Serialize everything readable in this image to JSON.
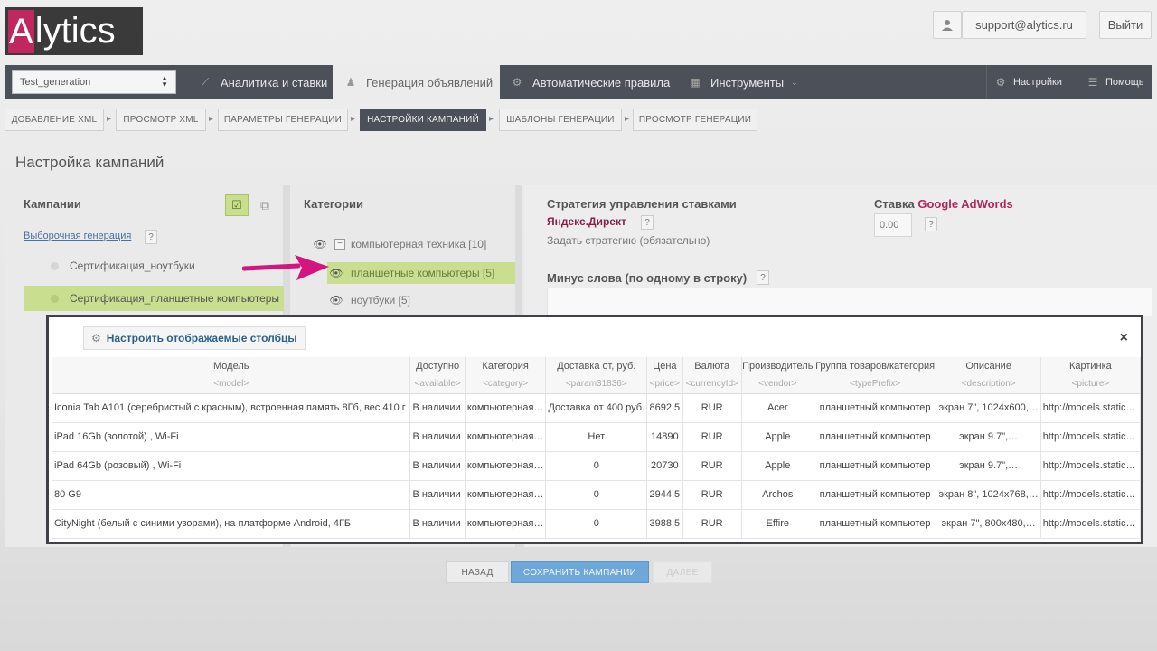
{
  "header": {
    "logo_text": "lytics",
    "logo_letter": "A",
    "support_email": "support@alytics.ru",
    "logout_label": "Выйти"
  },
  "topnav": {
    "project": "Test_generation",
    "tabs": [
      {
        "label": "Аналитика и ставки",
        "icon": "chart-icon"
      },
      {
        "label": "Генерация объявлений",
        "icon": "generator-icon"
      },
      {
        "label": "Автоматические правила",
        "icon": "rules-icon"
      },
      {
        "label": "Инструменты",
        "icon": "tools-icon"
      }
    ],
    "settings_label": "Настройки",
    "help_label": "Помощь"
  },
  "steps": [
    "ДОБАВЛЕНИЕ XML",
    "ПРОСМОТР XML",
    "ПАРАМЕТРЫ ГЕНЕРАЦИИ",
    "НАСТРОЙКИ КАМПАНИЙ",
    "ШАБЛОНЫ ГЕНЕРАЦИИ",
    "ПРОСМОТР ГЕНЕРАЦИИ"
  ],
  "page_title": "Настройка кампаний",
  "campaigns": {
    "title": "Кампании",
    "selective_link": "Выборочная генерация",
    "items": [
      "Сертификация_ноутбуки",
      "Сертификация_планшетные компьютеры"
    ]
  },
  "categories": {
    "title": "Категории",
    "items": [
      {
        "label": "компьютерная техника [10]"
      },
      {
        "label": "планшетные компьютеры [5]"
      },
      {
        "label": "ноутбуки [5]"
      }
    ]
  },
  "strategy": {
    "title": "Стратегия управления ставками",
    "system": "Яндекс.Директ",
    "set_strategy": "Задать стратегию (обязательно)",
    "bid_label": "Ставка",
    "bid_system": "Google AdWords",
    "bid_value": "0.00",
    "minus_label": "Минус слова (по одному в строку)",
    "qmark": "?"
  },
  "modal": {
    "configure_label": "Настроить отображаемые столбцы",
    "close": "×",
    "columns": [
      {
        "title": "Модель",
        "key": "<model>"
      },
      {
        "title": "Доступно",
        "key": "<available>"
      },
      {
        "title": "Категория",
        "key": "<category>"
      },
      {
        "title": "Доставка от, руб.",
        "key": "<param31836>"
      },
      {
        "title": "Цена",
        "key": "<price>"
      },
      {
        "title": "Валюта",
        "key": "<currencyId>"
      },
      {
        "title": "Производитель",
        "key": "<vendor>"
      },
      {
        "title": "Группа товаров/категория",
        "key": "<typePrefix>"
      },
      {
        "title": "Описание",
        "key": "<description>"
      },
      {
        "title": "Картинка",
        "key": "<picture>"
      }
    ],
    "rows": [
      [
        "Iconia Tab A101 (серебристый с красным), встроенная память 8Гб, вес 410 г",
        "В наличии",
        "компьютерная…",
        "Доставка от 400 руб.",
        "8692.5",
        "RUR",
        "Acer",
        "планшетный компьютер",
        "экран 7\", 1024x600,…",
        "http://models.static…"
      ],
      [
        "iPad 16Gb (золотой) , Wi-Fi",
        "В наличии",
        "компьютерная…",
        "Нет",
        "14890",
        "RUR",
        "Apple",
        "планшетный компьютер",
        "экран 9.7\",…",
        "http://models.static…"
      ],
      [
        "iPad 64Gb (розовый) , Wi-Fi",
        "В наличии",
        "компьютерная…",
        "0",
        "20730",
        "RUR",
        "Apple",
        "планшетный компьютер",
        "экран 9.7\",…",
        "http://models.static…"
      ],
      [
        "80 G9",
        "В наличии",
        "компьютерная…",
        "0",
        "2944.5",
        "RUR",
        "Archos",
        "планшетный компьютер",
        "экран 8\", 1024x768,…",
        "http://models.static…"
      ],
      [
        "CityNight (белый с синими узорами), на платформе Android, 4ГБ",
        "В наличии",
        "компьютерная…",
        "0",
        "3988.5",
        "RUR",
        "Effire",
        "планшетный компьютер",
        "экран 7\", 800x480,…",
        "http://models.static…"
      ]
    ]
  },
  "buttons": {
    "back": "НАЗАД",
    "save": "СОХРАНИТЬ КАМПАНИИ",
    "next": "ДАЛЕЕ"
  },
  "colors": {
    "nav_dark": "#4c5058",
    "accent_green": "#c9de8e",
    "brand_pink": "#c0275f",
    "arrow_magenta": "#d4147f",
    "save_blue": "#6ea7d9"
  }
}
